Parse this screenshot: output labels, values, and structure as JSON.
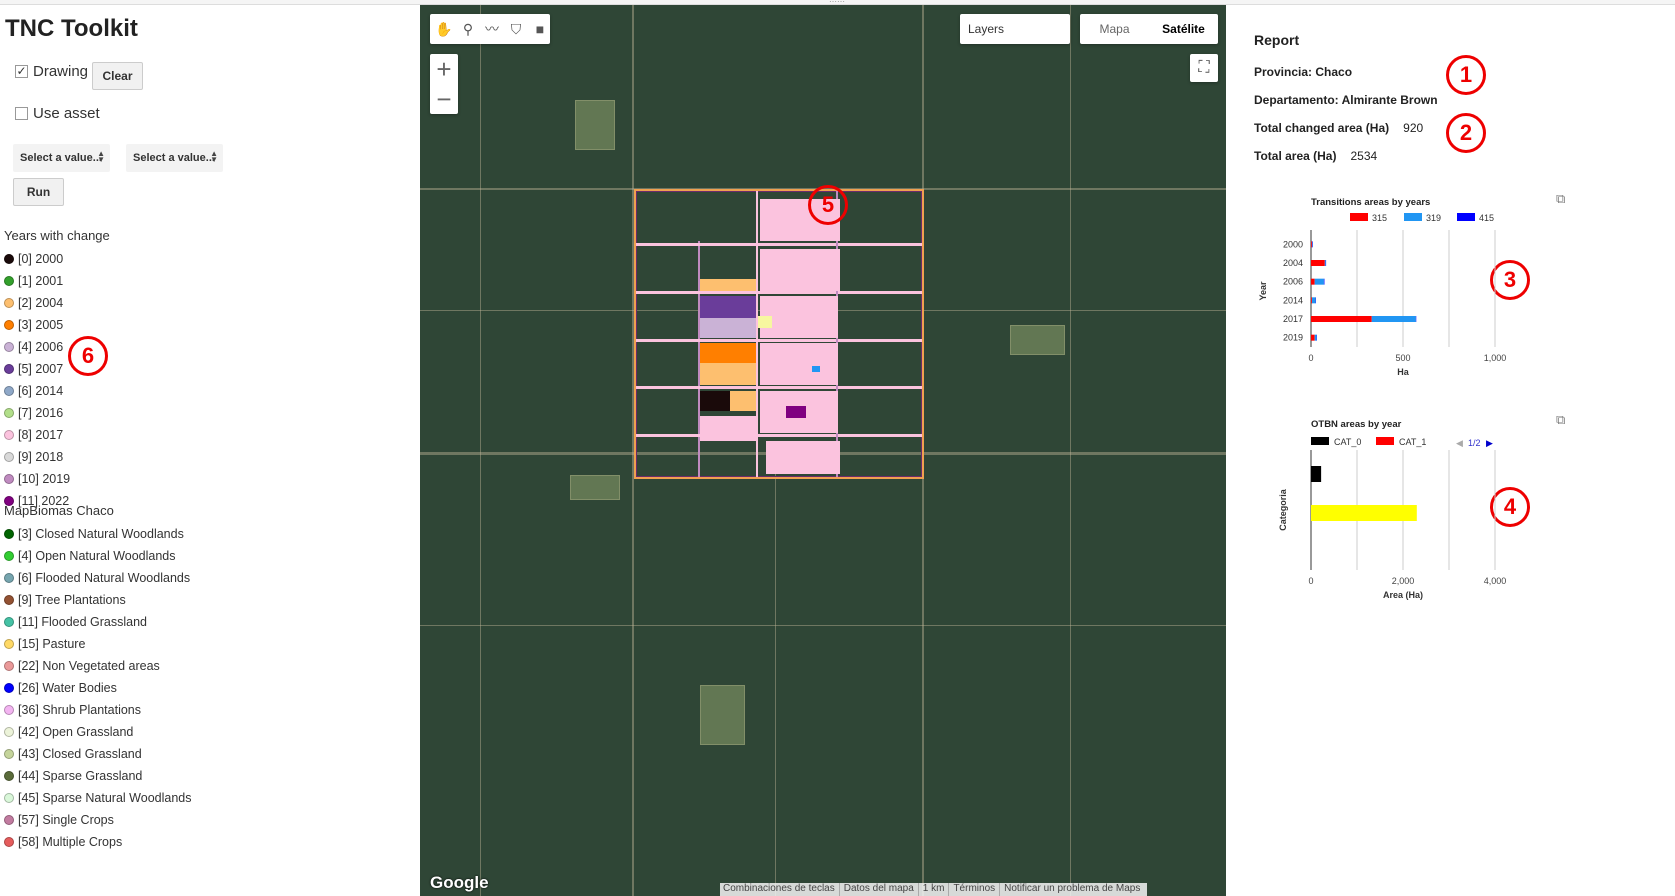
{
  "app_title": "TNC Toolkit",
  "drawing": {
    "label": "Drawing",
    "checked": true
  },
  "clear_label": "Clear",
  "use_asset": {
    "label": "Use asset",
    "checked": false
  },
  "select1": "Select a value...",
  "select2": "Select a value...",
  "run_label": "Run",
  "years_title": "Years with change",
  "years": [
    {
      "label": "[0] 2000",
      "color": "#1a0a0a"
    },
    {
      "label": "[1] 2001",
      "color": "#33a02c"
    },
    {
      "label": "[2] 2004",
      "color": "#fdbf6f"
    },
    {
      "label": "[3] 2005",
      "color": "#ff7f00"
    },
    {
      "label": "[4] 2006",
      "color": "#cab2d6"
    },
    {
      "label": "[5] 2007",
      "color": "#6a3d9a"
    },
    {
      "label": "[6] 2014",
      "color": "#8fa8c8"
    },
    {
      "label": "[7] 2016",
      "color": "#b2df8a"
    },
    {
      "label": "[8] 2017",
      "color": "#fbc3de"
    },
    {
      "label": "[9] 2018",
      "color": "#d9d9d9"
    },
    {
      "label": "[10] 2019",
      "color": "#c08bc0"
    },
    {
      "label": "[11] 2022",
      "color": "#800080"
    }
  ],
  "mapbiomas_title": "MapBiomas Chaco",
  "mapbiomas": [
    {
      "label": "[3] Closed Natural Woodlands",
      "color": "#006400"
    },
    {
      "label": "[4] Open Natural Woodlands",
      "color": "#32cd32"
    },
    {
      "label": "[6] Flooded Natural Woodlands",
      "color": "#76a5af"
    },
    {
      "label": "[9] Tree Plantations",
      "color": "#935132"
    },
    {
      "label": "[11] Flooded Grassland",
      "color": "#45c2a5"
    },
    {
      "label": "[15] Pasture",
      "color": "#ffd966"
    },
    {
      "label": "[22] Non Vegetated areas",
      "color": "#ea9999"
    },
    {
      "label": "[26] Water Bodies",
      "color": "#0000ff"
    },
    {
      "label": "[36] Shrub Plantations",
      "color": "#f3b4f1"
    },
    {
      "label": "[42] Open Grassland",
      "color": "#ecf3d9"
    },
    {
      "label": "[43] Closed Grassland",
      "color": "#c5d49b"
    },
    {
      "label": "[44] Sparse Grassland",
      "color": "#5a6b3a"
    },
    {
      "label": "[45] Sparse Natural Woodlands",
      "color": "#d9f7d9"
    },
    {
      "label": "[57] Single Crops",
      "color": "#c27ba0"
    },
    {
      "label": "[58] Multiple Crops",
      "color": "#e55c5c"
    }
  ],
  "map": {
    "layers_label": "Layers",
    "maptype": [
      "Mapa",
      "Satélite"
    ],
    "active_maptype": "Satélite",
    "zoom_in": "+",
    "zoom_out": "−",
    "google": "Google",
    "attribution": [
      "Combinaciones de teclas",
      "Datos del mapa",
      "1 km",
      "Términos",
      "Notificar un problema de Maps"
    ]
  },
  "report": {
    "title": "Report",
    "provincia": "Provincia: Chaco",
    "departamento": "Departamento: Almirante Brown",
    "changed_label": "Total changed area (Ha)",
    "changed_value": "920",
    "total_label": "Total area (Ha)",
    "total_value": "2534"
  },
  "annotations": [
    "1",
    "2",
    "3",
    "4",
    "5",
    "6"
  ],
  "chart_data": [
    {
      "type": "bar",
      "orientation": "horizontal",
      "title": "Transitions areas by years",
      "xlabel": "Ha",
      "ylabel": "Year",
      "categories": [
        "2000",
        "2004",
        "2006",
        "2014",
        "2017",
        "2019"
      ],
      "series": [
        {
          "name": "315",
          "color": "#ff0000",
          "values": [
            5,
            75,
            20,
            5,
            330,
            20
          ]
        },
        {
          "name": "319",
          "color": "#2196f3",
          "values": [
            3,
            5,
            50,
            20,
            240,
            10
          ]
        },
        {
          "name": "415",
          "color": "#0000ff",
          "values": [
            2,
            2,
            3,
            2,
            2,
            2
          ]
        }
      ],
      "xticks": [
        "0",
        "500",
        "1,000"
      ],
      "xlim": [
        0,
        1000
      ],
      "legend": "top"
    },
    {
      "type": "bar",
      "orientation": "horizontal",
      "title": "OTBN areas by year",
      "xlabel": "Area (Ha)",
      "ylabel": "Categoria",
      "legend_entries": [
        {
          "name": "CAT_0",
          "color": "#000000"
        },
        {
          "name": "CAT_1",
          "color": "#ff0000"
        }
      ],
      "legend_page": "1/2",
      "bars": [
        {
          "color": "#000000",
          "value": 220
        },
        {
          "color": "#ffff00",
          "value": 2300
        }
      ],
      "xticks": [
        "0",
        "2,000",
        "4,000"
      ],
      "xlim": [
        0,
        4000
      ],
      "legend": "top"
    }
  ]
}
